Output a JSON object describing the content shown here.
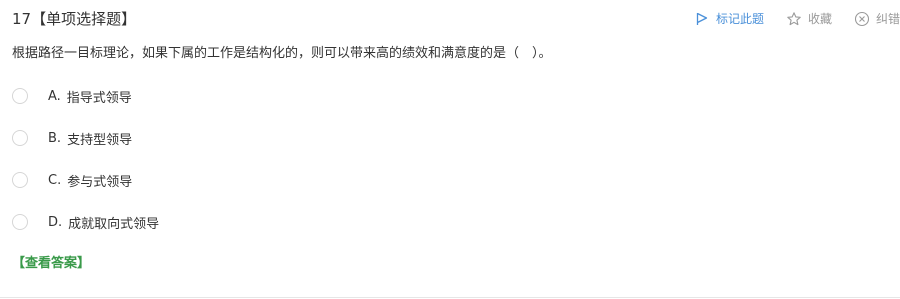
{
  "question": {
    "title": "17【单项选择题】",
    "stem": "根据路径一目标理论，如果下属的工作是结构化的，则可以带来高的绩效和满意度的是（　）。",
    "options": [
      {
        "letter": "A.",
        "text": "指导式领导"
      },
      {
        "letter": "B.",
        "text": "支持型领导"
      },
      {
        "letter": "C.",
        "text": "参与式领导"
      },
      {
        "letter": "D.",
        "text": "成就取向式领导"
      }
    ],
    "show_answer": "【查看答案】"
  },
  "actions": {
    "mark_label": "标记此题",
    "favorite_label": "收藏",
    "report_label": "纠错"
  },
  "colors": {
    "accent": "#4a90d9",
    "answer_green": "#3a9a4a",
    "muted": "#999999"
  },
  "icons": {
    "mark": "flag-icon",
    "favorite": "star-icon",
    "report": "close-circle-icon"
  }
}
